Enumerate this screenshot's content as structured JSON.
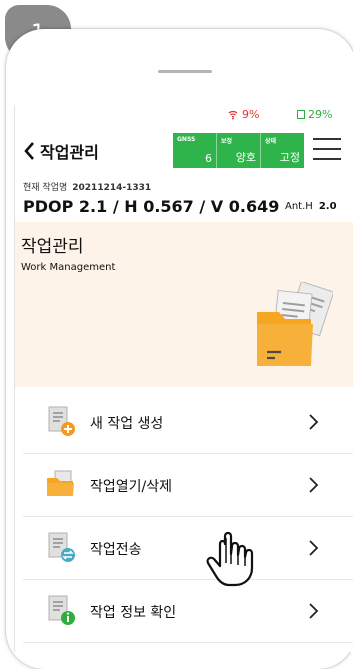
{
  "step": {
    "number": "1"
  },
  "status_bar": {
    "signal_percent": "9%",
    "battery_percent": "29%",
    "signal_color": "#e6322e",
    "battery_color": "#2fae3f"
  },
  "header": {
    "title": "작업관리",
    "gnss": [
      {
        "label": "GNSS",
        "value": "6"
      },
      {
        "label": "보정",
        "value": "양호"
      },
      {
        "label": "상태",
        "value": "고정"
      }
    ],
    "gnss_color": "#2fb34b"
  },
  "job": {
    "label": "현재 작업명",
    "value": "20211214-1331"
  },
  "precision": {
    "pdop_line": "PDOP 2.1 / H 0.567 / V 0.649",
    "ant_label": "Ant.H",
    "ant_value": "2.0"
  },
  "banner": {
    "title": "작업관리",
    "subtitle": "Work Management",
    "icon": "folder-document-icon",
    "background": "#fdf3e9"
  },
  "menu": [
    {
      "label": "새 작업 생성",
      "icon": "new-document-icon"
    },
    {
      "label": "작업열기/삭제",
      "icon": "folder-icon"
    },
    {
      "label": "작업전송",
      "icon": "transfer-document-icon"
    },
    {
      "label": "작업 정보 확인",
      "icon": "info-document-icon"
    }
  ],
  "cursor": {
    "icon": "hand-pointer-icon"
  }
}
